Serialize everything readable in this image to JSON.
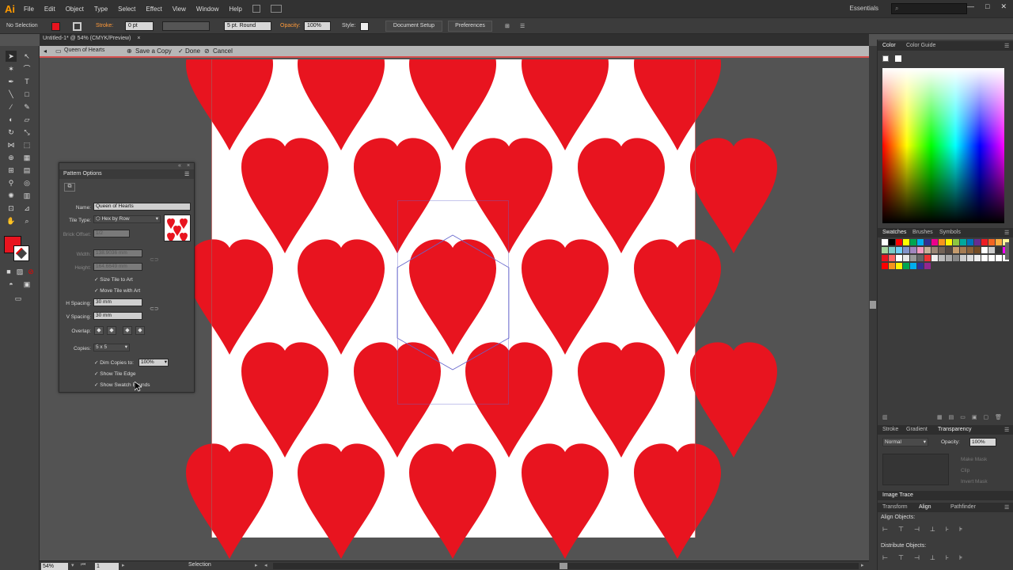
{
  "app": {
    "logo": "Ai",
    "menus": [
      "File",
      "Edit",
      "Object",
      "Type",
      "Select",
      "Effect",
      "View",
      "Window",
      "Help"
    ],
    "workspace": "Essentials",
    "search_placeholder": ""
  },
  "control_bar": {
    "selection": "No Selection",
    "stroke_label": "Stroke:",
    "stroke_value": "0 pt",
    "brush": "5 pt. Round",
    "opacity_label": "Opacity:",
    "opacity_value": "100%",
    "style_label": "Style:",
    "document_setup": "Document Setup",
    "preferences": "Preferences",
    "fill_color": "#e8141f"
  },
  "document": {
    "tab_title": "Untitled-1* @ 54% (CMYK/Preview)",
    "isolation_name": "Queen of Hearts",
    "save_copy": "Save a Copy",
    "done": "Done",
    "cancel": "Cancel"
  },
  "pattern_options": {
    "title": "Pattern Options",
    "name_label": "Name:",
    "name_value": "Queen of Hearts",
    "tile_type_label": "Tile Type:",
    "tile_type_value": "Hex by Row",
    "brick_offset_label": "Brick Offset:",
    "brick_offset_value": "1/2",
    "width_label": "Width:",
    "width_value": "138.9036 mm",
    "height_label": "Height:",
    "height_value": "164.6649 mm",
    "size_tile_to_art": "Size Tile to Art",
    "move_tile_with_art": "Move Tile with Art",
    "h_spacing_label": "H Spacing:",
    "h_spacing_value": "30 mm",
    "v_spacing_label": "V Spacing:",
    "v_spacing_value": "30 mm",
    "overlap_label": "Overlap:",
    "copies_label": "Copies:",
    "copies_value": "5 x 5",
    "dim_copies_label": "Dim Copies to:",
    "dim_copies_value": "100%",
    "show_tile_edge": "Show Tile Edge",
    "show_swatch_bounds": "Show Swatch Bounds"
  },
  "right_panel": {
    "color_tabs": [
      "Color",
      "Color Guide"
    ],
    "swatch_tabs": [
      "Swatches",
      "Brushes",
      "Symbols"
    ],
    "transparency_tabs": [
      "Stroke",
      "Gradient",
      "Transparency"
    ],
    "blend_mode": "Normal",
    "opacity_label": "Opacity:",
    "opacity_value": "100%",
    "make_mask": "Make Mask",
    "clip": "Clip",
    "invert_mask": "Invert Mask",
    "image_trace": "Image Trace",
    "align_tabs": [
      "Transform",
      "Align",
      "Pathfinder"
    ],
    "align_objects": "Align Objects:",
    "distribute_objects": "Distribute Objects:"
  },
  "status": {
    "zoom": "54%",
    "artboard": "1",
    "tool": "Selection"
  },
  "colors": {
    "heart": "#e8141f",
    "accent_line": "#d6504f"
  }
}
